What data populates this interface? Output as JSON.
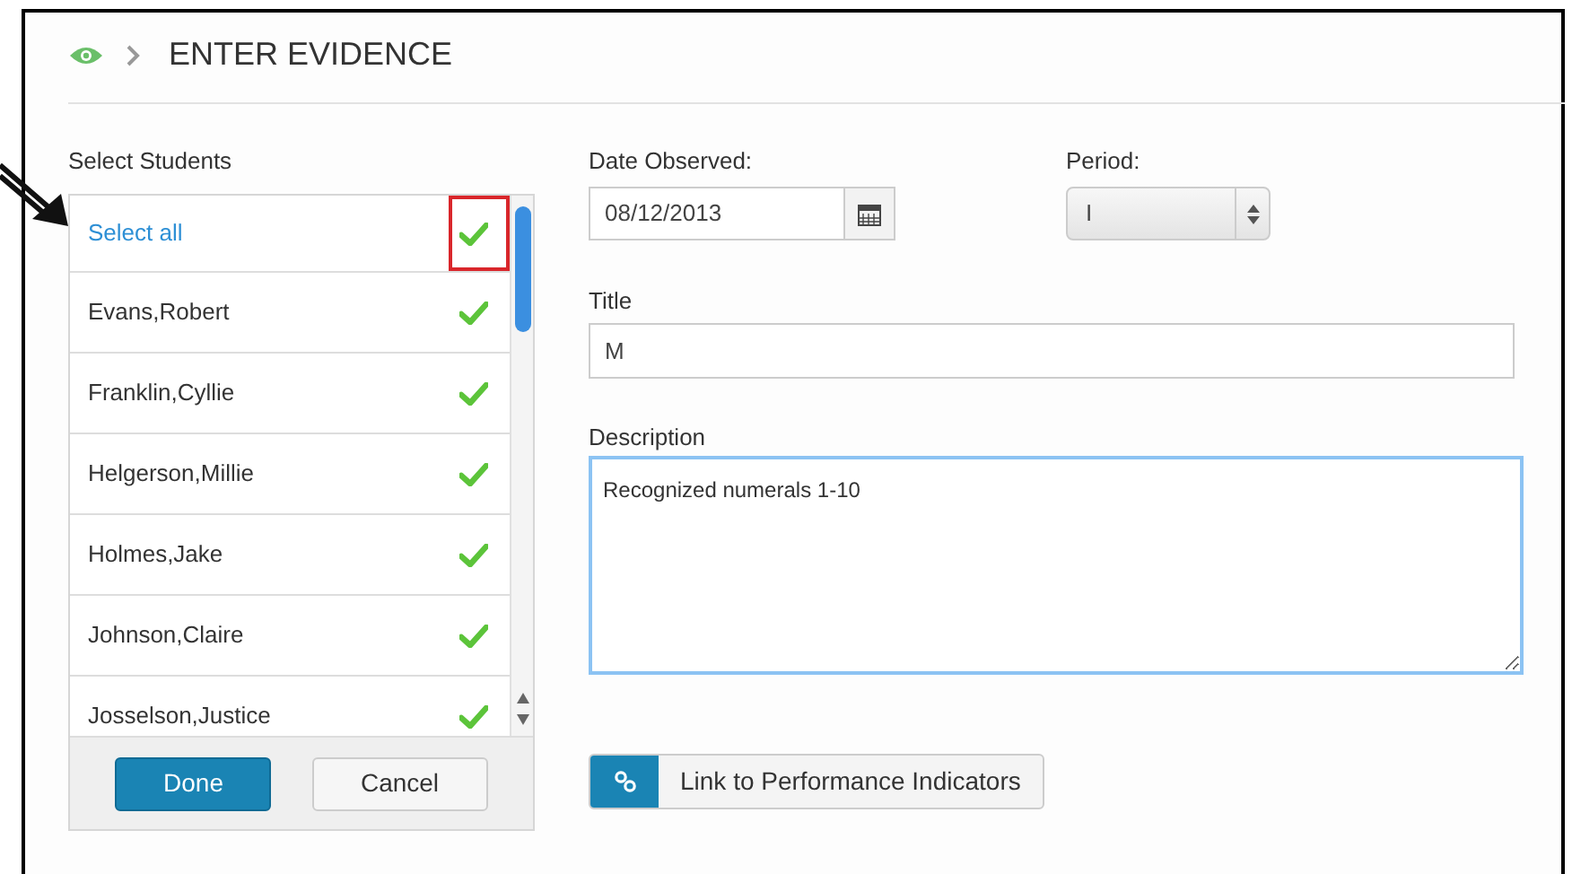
{
  "header": {
    "title": "ENTER EVIDENCE"
  },
  "students": {
    "label": "Select Students",
    "select_all": {
      "label": "Select all",
      "checked": true,
      "highlighted": true
    },
    "items": [
      {
        "name": "Evans,Robert",
        "checked": true
      },
      {
        "name": "Franklin,Cyllie",
        "checked": true
      },
      {
        "name": "Helgerson,Millie",
        "checked": true
      },
      {
        "name": "Holmes,Jake",
        "checked": true
      },
      {
        "name": "Johnson,Claire",
        "checked": true
      },
      {
        "name": "Josselson,Justice",
        "checked": true
      }
    ],
    "buttons": [
      "Done",
      "Cancel"
    ]
  },
  "date": {
    "label": "Date Observed:",
    "value": "08/12/2013"
  },
  "period": {
    "label": "Period:",
    "value": "I"
  },
  "title": {
    "label": "Title",
    "value": "M"
  },
  "description": {
    "label": "Description",
    "value": "Recognized numerals 1-10",
    "focused": true
  },
  "link_button": {
    "label": "Link to Performance Indicators"
  }
}
